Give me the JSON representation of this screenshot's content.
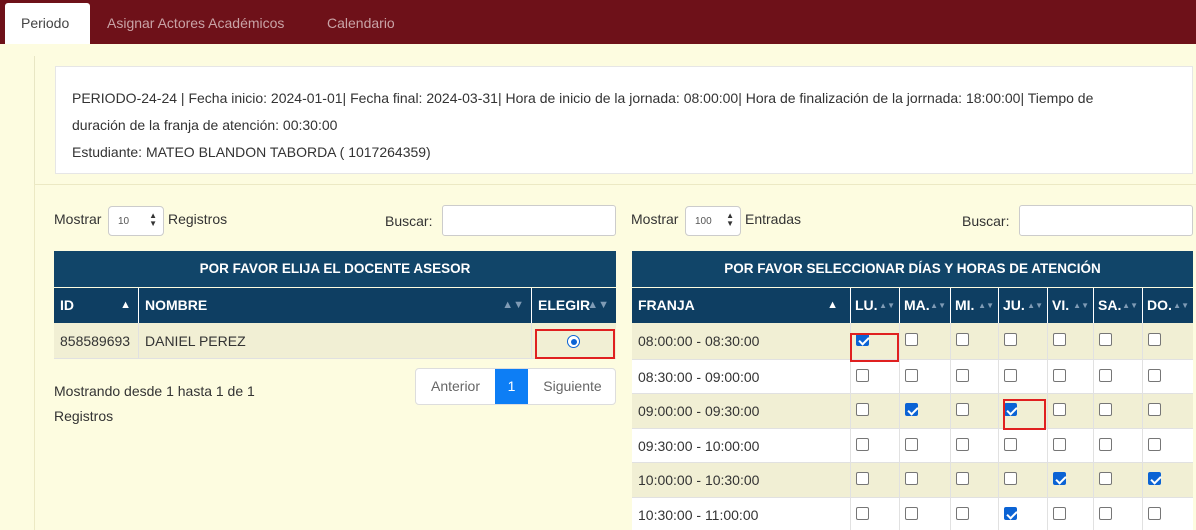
{
  "tabs": [
    {
      "label": "Periodo",
      "active": true
    },
    {
      "label": "Asignar Actores Académicos",
      "active": false
    },
    {
      "label": "Calendario",
      "active": false
    }
  ],
  "period_info": {
    "line1": "PERIODO-24-24 | Fecha inicio: 2024-01-01| Fecha final: 2024-03-31| Hora de inicio de la jornada: 08:00:00| Hora de finalización de la jorrnada: 18:00:00| Tiempo de",
    "line2": "duración de la franja de atención: 00:30:00",
    "line3": "Estudiante: MATEO BLANDON TABORDA ( 1017264359)"
  },
  "left_table": {
    "show_label": "Mostrar",
    "show_value": "10",
    "records_label": "Registros",
    "search_label": "Buscar:",
    "title": "POR FAVOR ELIJA EL DOCENTE ASESOR",
    "headers": [
      "ID",
      "NOMBRE",
      "ELEGIR"
    ],
    "rows": [
      {
        "id": "858589693",
        "name": "DANIEL PEREZ",
        "selected": true
      }
    ],
    "info_line1": "Mostrando desde 1 hasta 1 de 1",
    "info_line2": "Registros",
    "pager": {
      "prev": "Anterior",
      "current": "1",
      "next": "Siguiente"
    }
  },
  "right_table": {
    "show_label": "Mostrar",
    "show_value": "100",
    "entries_label": "Entradas",
    "search_label": "Buscar:",
    "title": "POR FAVOR SELECCIONAR DÍAS Y HORAS DE ATENCIÓN",
    "headers": [
      "FRANJA",
      "LU.",
      "MA.",
      "MI.",
      "JU.",
      "VI.",
      "SA.",
      "DO."
    ],
    "rows": [
      {
        "franja": "08:00:00 - 08:30:00",
        "checks": [
          true,
          false,
          false,
          false,
          false,
          false,
          false
        ]
      },
      {
        "franja": "08:30:00 - 09:00:00",
        "checks": [
          false,
          false,
          false,
          false,
          false,
          false,
          false
        ]
      },
      {
        "franja": "09:00:00 - 09:30:00",
        "checks": [
          false,
          true,
          false,
          true,
          false,
          false,
          false
        ]
      },
      {
        "franja": "09:30:00 - 10:00:00",
        "checks": [
          false,
          false,
          false,
          false,
          false,
          false,
          false
        ]
      },
      {
        "franja": "10:00:00 - 10:30:00",
        "checks": [
          false,
          false,
          false,
          false,
          true,
          false,
          true
        ]
      },
      {
        "franja": "10:30:00 - 11:00:00",
        "checks": [
          false,
          false,
          false,
          true,
          false,
          false,
          false
        ]
      }
    ]
  }
}
